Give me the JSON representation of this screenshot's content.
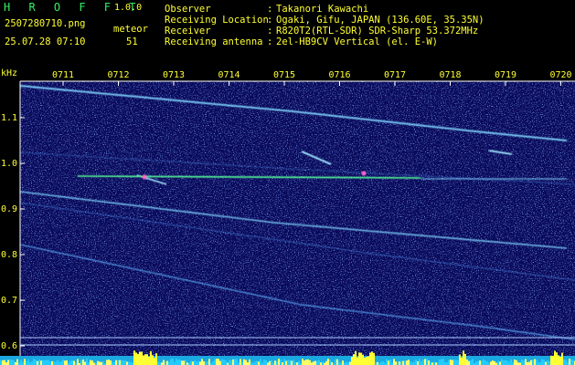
{
  "app": {
    "logo": "H R O F F T",
    "version": "1.0.0"
  },
  "file": {
    "name": "2507280710.png",
    "datetime": "25.07.28 07:10"
  },
  "meteor": {
    "label": "meteor",
    "count": "51"
  },
  "info": [
    {
      "key": "Observer",
      "value": "Takanori Kawachi"
    },
    {
      "key": "Receiving Location",
      "value": "Ogaki, Gifu, JAPAN (136.60E, 35.35N)"
    },
    {
      "key": "Receiver",
      "value": "R820T2(RTL-SDR) SDR-Sharp 53.372MHz"
    },
    {
      "key": "Receiving antenna",
      "value": "2el-HB9CV Vertical (el. E-W)"
    }
  ],
  "info_separator": ":",
  "spectrogram": {
    "y_unit": "kHz",
    "y_ticks": [
      "1.1",
      "1.0",
      "0.9",
      "0.8",
      "0.7",
      "0.6"
    ],
    "x_ticks": [
      "0711",
      "0712",
      "0713",
      "0714",
      "0715",
      "0716",
      "0717",
      "0718",
      "0719",
      "0720"
    ],
    "colors": {
      "background": "#0a0a5a",
      "noise": "#2a4cc8",
      "signal": "#7fd6ff",
      "carrier": "#55ff99",
      "axis": "#ffffff",
      "level": "#ffff33",
      "baseline": "#22ccff"
    }
  }
}
